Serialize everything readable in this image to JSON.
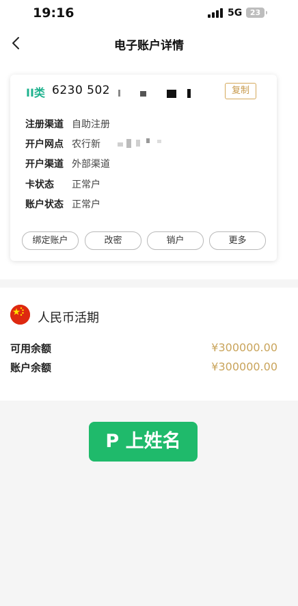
{
  "status_bar": {
    "time": "19:16",
    "network": "5G",
    "battery": "23"
  },
  "nav": {
    "title": "电子账户详情",
    "back_icon": "chevron-left-icon"
  },
  "account": {
    "class_label": "II类",
    "card_number": "6230 502",
    "copy_label": "复制",
    "rows": [
      {
        "label": "注册渠道",
        "value": "自助注册"
      },
      {
        "label": "开户网点",
        "value": "农行新"
      },
      {
        "label": "开户渠道",
        "value": "外部渠道"
      },
      {
        "label": "卡状态",
        "value": "正常户"
      },
      {
        "label": "账户状态",
        "value": "正常户"
      }
    ],
    "actions": [
      "绑定账户",
      "改密",
      "销户",
      "更多"
    ]
  },
  "balance": {
    "flag_icon": "china-flag-icon",
    "currency_title": "人民币活期",
    "available_label": "可用余额",
    "available_value": "¥300000.00",
    "account_balance_label": "账户余额",
    "account_balance_value": "¥300000.00"
  },
  "overlay": {
    "text": "P 上姓名"
  },
  "colors": {
    "accent_green": "#1fb28e",
    "gold": "#c9a45b",
    "overlay_green": "#1fba6b",
    "flag_red": "#de2910"
  }
}
